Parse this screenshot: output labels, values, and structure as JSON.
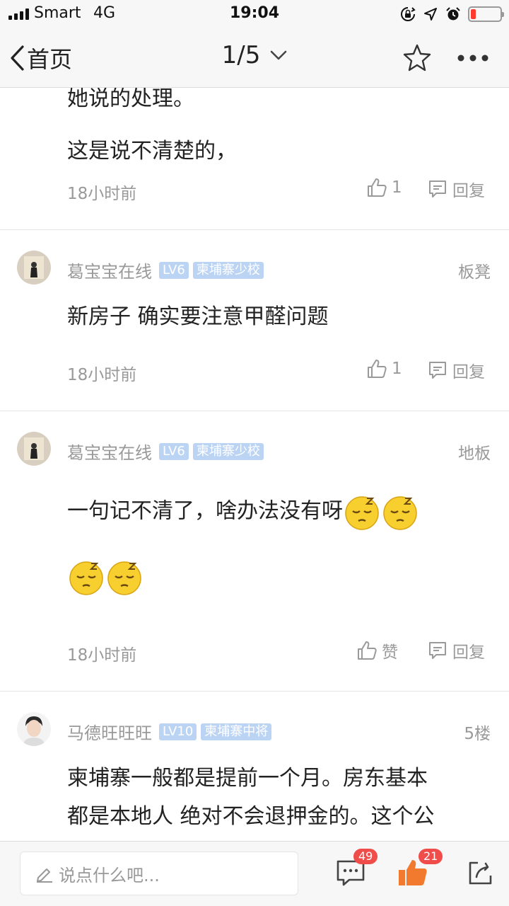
{
  "status_bar": {
    "carrier": "Smart",
    "network": "4G",
    "time": "19:04"
  },
  "nav": {
    "back_label": "首页",
    "page_indicator": "1/5"
  },
  "top_post": {
    "lines": [
      "她说的处理。",
      "这是说不清楚的，"
    ],
    "time": "18小时前",
    "like_count": "1",
    "reply_label": "回复"
  },
  "posts": [
    {
      "username": "葛宝宝在线",
      "level": "LV6",
      "rank": "柬埔寨少校",
      "floor": "板凳",
      "text": "新房子 确实要注意甲醛问题",
      "time": "18小时前",
      "like_label": "1",
      "reply_label": "回复"
    },
    {
      "username": "葛宝宝在线",
      "level": "LV6",
      "rank": "柬埔寨少校",
      "floor": "地板",
      "text": "一句记不清了，啥办法没有呀",
      "time": "18小时前",
      "like_label": "赞",
      "reply_label": "回复"
    },
    {
      "username": "马德旺旺旺",
      "level": "LV10",
      "rank": "柬埔寨中将",
      "floor": "5楼",
      "lines": [
        "柬埔寨一般都是提前一个月。房东基本",
        "都是本地人 绝对不会退押金的。这个公"
      ]
    }
  ],
  "bottom_bar": {
    "comment_placeholder": "说点什么吧...",
    "comment_count": "49",
    "like_count": "21"
  },
  "colors": {
    "badge_bg": "#bcd4f3",
    "like_accent": "#f27a2f",
    "count_badge": "#f04c49",
    "battery_low": "#ff3b30"
  },
  "icons": [
    "signal-icon",
    "lock-rotation-icon",
    "location-icon",
    "alarm-icon",
    "battery-icon",
    "back-chevron-icon",
    "chevron-down-icon",
    "star-icon",
    "more-icon",
    "thumb-up-icon",
    "reply-icon",
    "sleepy-emoji-icon",
    "pencil-icon",
    "comment-icon",
    "share-icon"
  ]
}
